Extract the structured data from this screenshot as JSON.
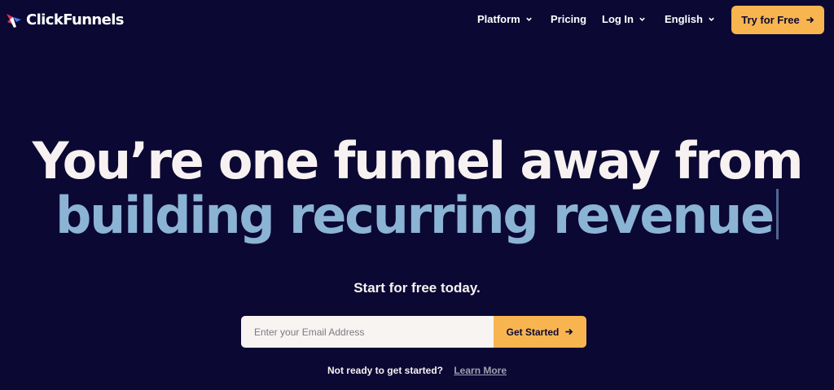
{
  "brand": {
    "name": "ClickFunnels"
  },
  "nav": {
    "items": [
      {
        "label": "Platform",
        "has_dropdown": true
      },
      {
        "label": "Pricing",
        "has_dropdown": false
      },
      {
        "label": "Log In",
        "has_dropdown": true
      },
      {
        "label": "English",
        "has_dropdown": true
      }
    ],
    "cta_label": "Try for Free"
  },
  "hero": {
    "headline_line1": "You’re one funnel away from",
    "headline_line2": "building recurring revenue",
    "subtitle": "Start for free today.",
    "email_placeholder": "Enter your Email Address",
    "email_value": "",
    "submit_label": "Get Started",
    "secondary_prompt": "Not ready to get started?",
    "learn_more_label": "Learn More"
  },
  "colors": {
    "background": "#0b0833",
    "accent": "#f8b54f",
    "headline_highlight": "#8bb3d4",
    "text": "#f7f2f1"
  },
  "icons": {
    "logo": "clickfunnels-logo-icon",
    "dropdown": "chevron-down-icon",
    "arrow": "arrow-right-icon"
  }
}
